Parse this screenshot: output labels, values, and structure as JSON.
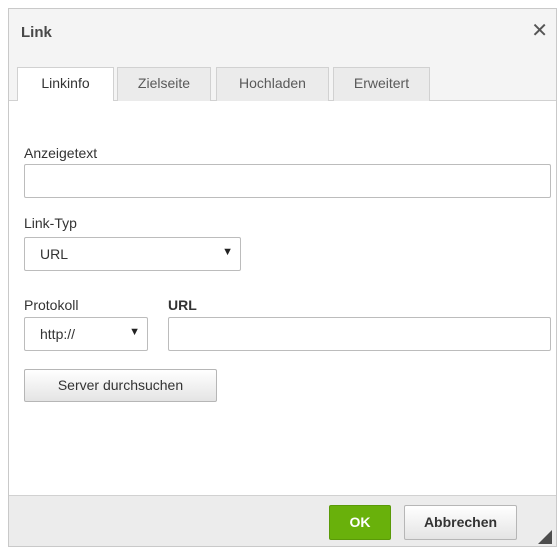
{
  "dialog": {
    "title": "Link",
    "close_glyph": "✕"
  },
  "tabs": [
    {
      "label": "Linkinfo",
      "active": true
    },
    {
      "label": "Zielseite",
      "active": false
    },
    {
      "label": "Hochladen",
      "active": false
    },
    {
      "label": "Erweitert",
      "active": false
    }
  ],
  "form": {
    "display_text": {
      "label": "Anzeigetext",
      "value": ""
    },
    "link_type": {
      "label": "Link-Typ",
      "value": "URL"
    },
    "protocol": {
      "label": "Protokoll",
      "value": "http://"
    },
    "url": {
      "label": "URL",
      "value": ""
    },
    "browse_server_label": "Server durchsuchen"
  },
  "footer": {
    "ok_label": "OK",
    "cancel_label": "Abbrechen"
  },
  "colors": {
    "ok_button": "#69b10b",
    "titlebar": "#f4f4f4",
    "footer": "#ececec"
  },
  "icons": {
    "close": "close-icon",
    "dropdown": "chevron-down-icon",
    "resize": "resize-handle-icon"
  }
}
